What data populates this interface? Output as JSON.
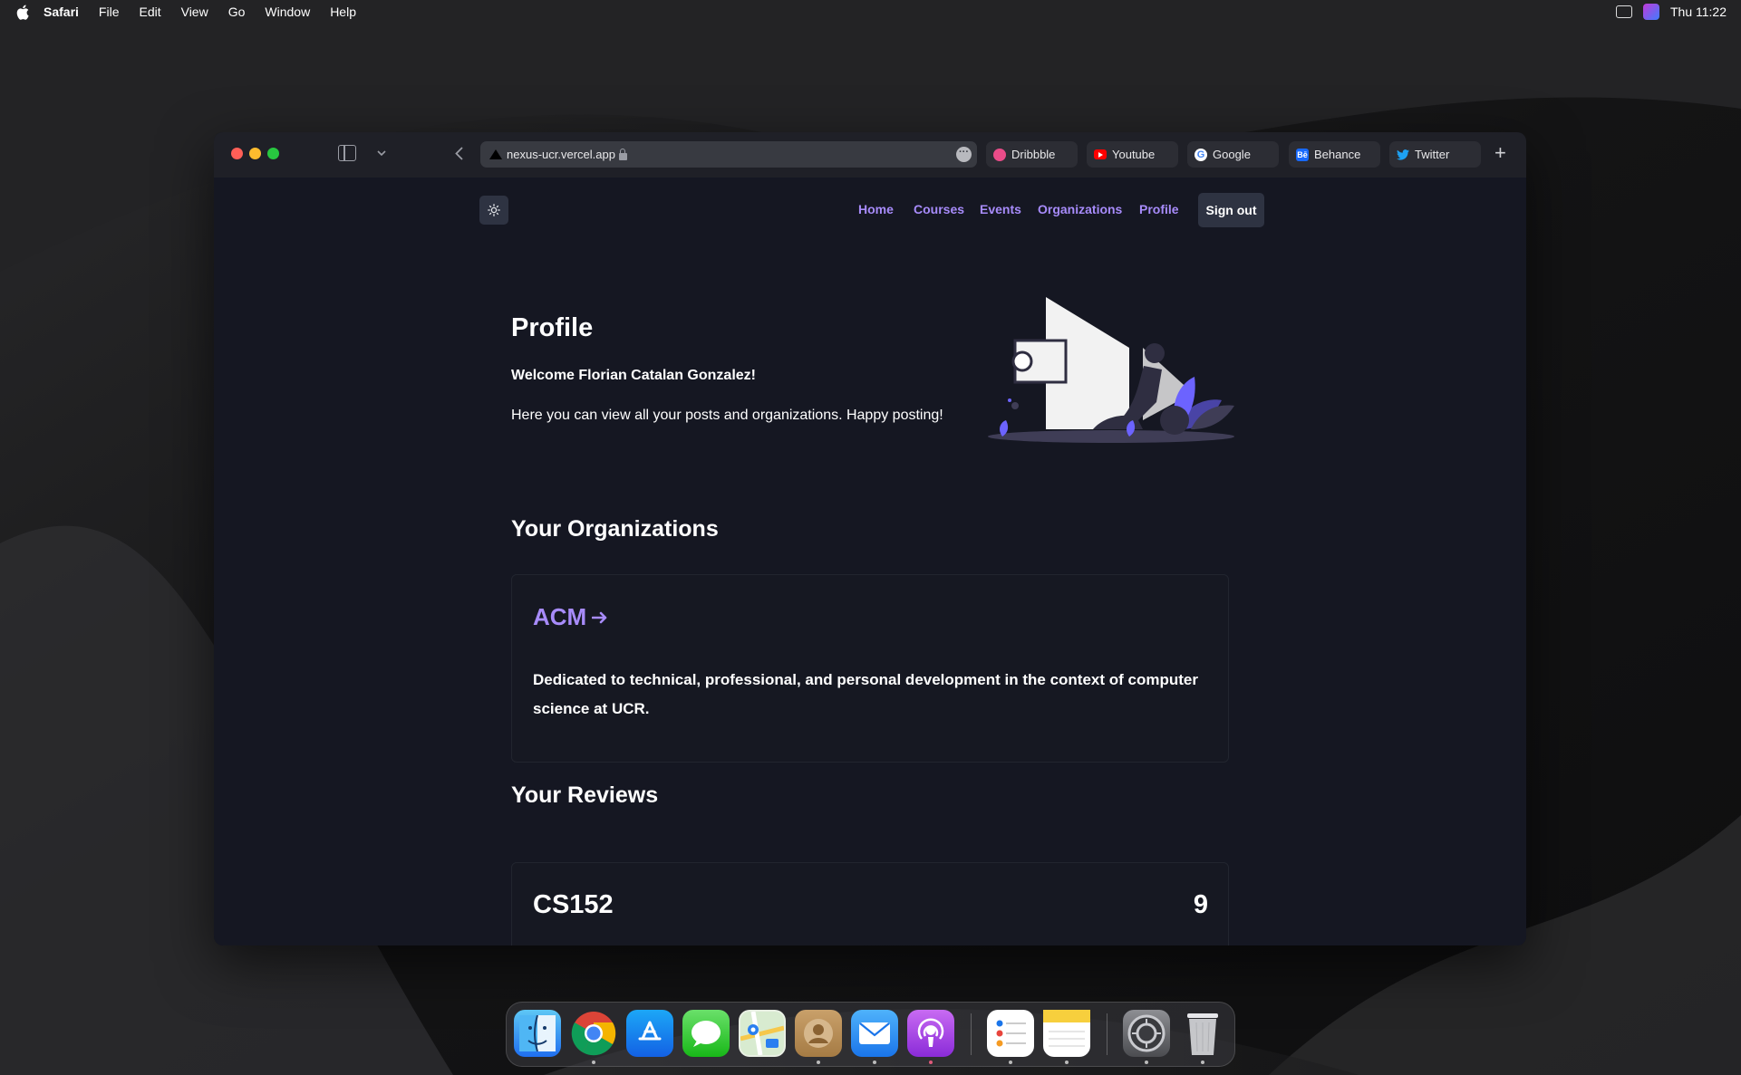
{
  "menubar": {
    "app_name": "Safari",
    "items": [
      "File",
      "Edit",
      "View",
      "Go",
      "Window",
      "Help"
    ],
    "clock": "Thu 11:22"
  },
  "browser": {
    "url": "nexus-ucr.vercel.app",
    "favorites": [
      {
        "label": "Dribbble",
        "icon": "dribbble-icon",
        "color": "#ea4c89"
      },
      {
        "label": "Youtube",
        "icon": "youtube-icon",
        "color": "#ff0000"
      },
      {
        "label": "Google",
        "icon": "google-icon",
        "color": "#4285f4"
      },
      {
        "label": "Behance",
        "icon": "behance-icon",
        "color": "#1769ff"
      },
      {
        "label": "Twitter",
        "icon": "twitter-icon",
        "color": "#1da1f2"
      }
    ]
  },
  "site": {
    "nav": {
      "home": "Home",
      "courses": "Courses",
      "events": "Events",
      "organizations": "Organizations",
      "profile": "Profile",
      "signout": "Sign out"
    },
    "profile": {
      "title": "Profile",
      "welcome": "Welcome Florian Catalan Gonzalez!",
      "intro": "Here you can view all your posts and organizations. Happy posting!"
    },
    "organizations": {
      "heading": "Your Organizations",
      "items": [
        {
          "name": "ACM",
          "description": "Dedicated to technical, professional, and personal development in the context of computer science at UCR."
        }
      ]
    },
    "reviews": {
      "heading": "Your Reviews",
      "items": [
        {
          "course": "CS152",
          "rating": "9"
        }
      ]
    },
    "accent_color": "#a78bfa"
  },
  "dock": {
    "apps": [
      "Finder",
      "Chrome",
      "App Store",
      "Messages",
      "Maps",
      "Contacts",
      "Mail",
      "Podcasts",
      "Reminders",
      "Notes",
      "System Preferences",
      "Trash"
    ]
  }
}
